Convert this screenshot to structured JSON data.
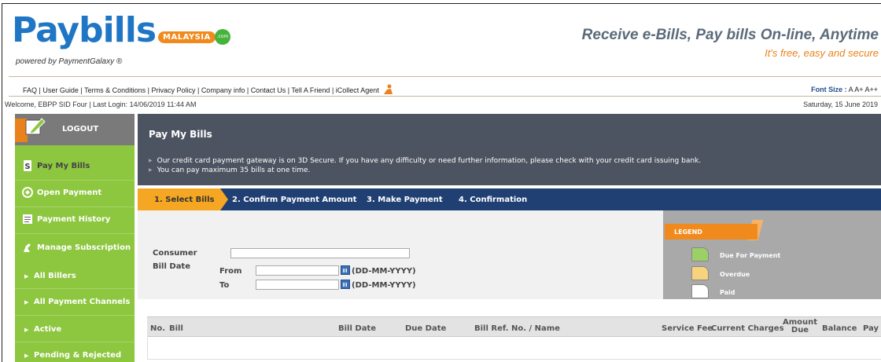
{
  "header": {
    "logo_main": "Paybills",
    "logo_sub": "MALAYSIA",
    "logo_dot": ".com",
    "powered_by": "powered by PaymentGalaxy ®",
    "tagline": "Receive e-Bills, Pay bills On-line, Anytime",
    "tagline_sub": "It's free, easy and secure"
  },
  "links": [
    "FAQ",
    "User Guide",
    "Terms & Conditions",
    "Privacy Policy",
    "Company info",
    "Contact Us",
    "Tell A Friend",
    "iCollect Agent"
  ],
  "font_size": {
    "label": "Font Size :",
    "options": [
      "A",
      "A+",
      "A++"
    ]
  },
  "welcome": "Welcome, EBPP SID Four | Last Login: 14/06/2019 11:44 AM",
  "date": "Saturday, 15 June 2019",
  "sidebar": {
    "logout": "LOGOUT",
    "items": [
      {
        "label": "Pay My Bills"
      },
      {
        "label": "Open Payment"
      },
      {
        "label": "Payment History"
      },
      {
        "label": "Manage Subscription"
      }
    ],
    "sub_items": [
      {
        "label": "All Billers"
      },
      {
        "label": "All Payment Channels"
      },
      {
        "label": "Active"
      },
      {
        "label": "Pending & Rejected"
      }
    ]
  },
  "main": {
    "title": "Pay My Bills",
    "notices": [
      "Our credit card payment gateway is on 3D Secure. If you have any difficulty or need further information, please check with your credit card issuing bank.",
      "You can pay maximum 35 bills at one time."
    ],
    "steps": [
      "1. Select Bills",
      "2. Confirm Payment Amount",
      "3. Make Payment",
      "4. Confirmation"
    ],
    "active_step": 0
  },
  "form": {
    "consumer_label": "Consumer",
    "consumer_value": "",
    "bill_date_label": "Bill Date",
    "from_label": "From",
    "to_label": "To",
    "from_value": "",
    "to_value": "",
    "date_format": "(DD-MM-YYYY)"
  },
  "legend": {
    "title": "LEGEND",
    "items": [
      {
        "label": "Due For Payment",
        "color": "#9cd067"
      },
      {
        "label": "Overdue",
        "color": "#f9d27d"
      },
      {
        "label": "Paid",
        "color": "#ffffff"
      }
    ]
  },
  "table": {
    "columns": [
      "No.",
      "Bill",
      "Bill Date",
      "Due Date",
      "Bill Ref. No. / Name",
      "Service Fee",
      "Current Charges",
      "Amount Due",
      "Balance",
      "Pay"
    ]
  },
  "colors": {
    "sidebar": "#8dc63f",
    "header_dark": "#4d5461",
    "steps_bar": "#203f73",
    "accent": "#f08a1c"
  }
}
